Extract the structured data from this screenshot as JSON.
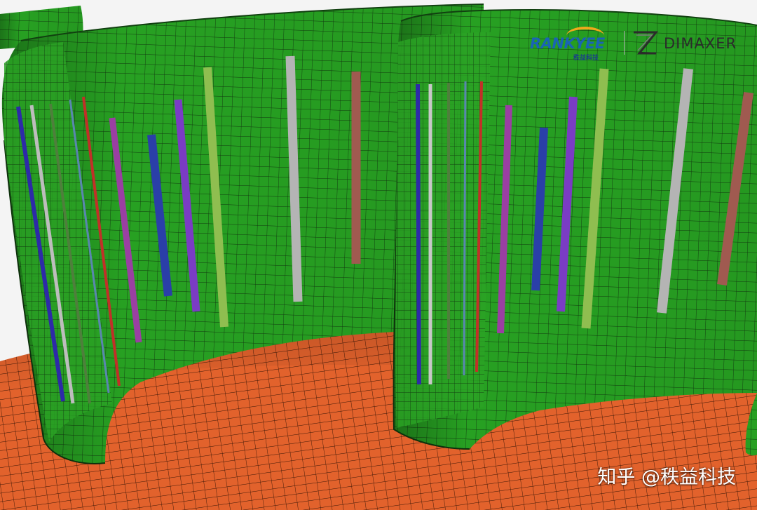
{
  "logo": {
    "rankyee_text": "RANKYEE",
    "rankyee_cn": "秩益科技",
    "dimaxer_text": "DIMAXER"
  },
  "watermark": {
    "text": "知乎 @秩益科技"
  },
  "colors": {
    "blade_green": "#27a022",
    "hub_orange": "#e2622c",
    "mesh_line": "#1a2a16",
    "background": "#f4f4f4"
  }
}
